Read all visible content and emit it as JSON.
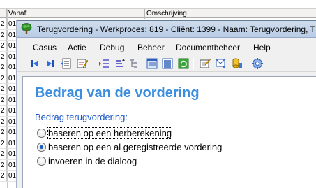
{
  "background_grid": {
    "columns": [
      "",
      "Vanaf",
      "Omschrijving"
    ],
    "rows": [
      {
        "n": "2",
        "v": "01"
      },
      {
        "n": "2",
        "v": "01"
      },
      {
        "n": "2",
        "v": "01"
      },
      {
        "n": "2",
        "v": "01"
      },
      {
        "n": "2",
        "v": "01"
      },
      {
        "n": "2",
        "v": "01"
      },
      {
        "n": "2",
        "v": "01"
      },
      {
        "n": "2",
        "v": "01"
      },
      {
        "n": "2",
        "v": "01"
      },
      {
        "n": "2",
        "v": "01"
      },
      {
        "n": "2",
        "v": "01"
      },
      {
        "n": "2",
        "v": "01"
      },
      {
        "n": "2",
        "v": "01"
      },
      {
        "n": "2",
        "v": "01"
      },
      {
        "n": "2",
        "v": "01"
      },
      {
        "n": "2",
        "v": "01"
      }
    ]
  },
  "window": {
    "title": "Terugvordering - Werkproces: 819 - Cliënt: 1399 - Naam: Terugvordering, T",
    "icon": "tree-icon"
  },
  "menu": {
    "items": [
      "Casus",
      "Actie",
      "Debug",
      "Beheer",
      "Documentbeheer",
      "Help"
    ]
  },
  "toolbar": {
    "buttons": [
      "first-record-icon",
      "last-record-icon",
      "document-list-icon",
      "edit-document-icon",
      "tasks-icon",
      "sort-icon",
      "tree-view-icon",
      "form-icon",
      "list-form-icon",
      "refresh-icon",
      "write-note-icon",
      "message-icon",
      "database-icon",
      "settings-icon"
    ]
  },
  "form": {
    "heading": "Bedrag van de vordering",
    "group_label": "Bedrag terugvordering:",
    "options": [
      {
        "label": "baseren op een herberekening",
        "checked": false,
        "focused": true
      },
      {
        "label": "baseren op een al geregistreerde vordering",
        "checked": true,
        "focused": false
      },
      {
        "label": "invoeren in de dialoog",
        "checked": false,
        "focused": false
      }
    ]
  },
  "colors": {
    "heading": "#3b8de0",
    "group_label": "#1a56c8",
    "titlebar": "#c4d5ea"
  }
}
